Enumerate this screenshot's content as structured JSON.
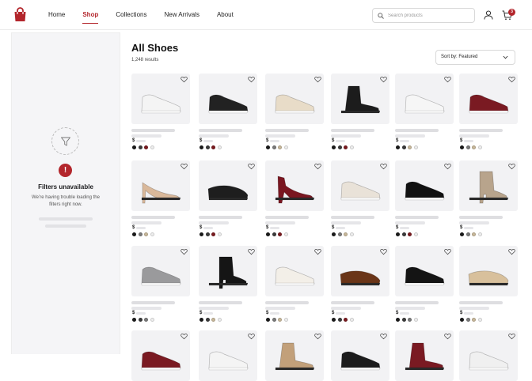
{
  "nav": {
    "items": [
      {
        "label": "Home",
        "active": false
      },
      {
        "label": "Shop",
        "active": true
      },
      {
        "label": "Collections",
        "active": false
      },
      {
        "label": "New Arrivals",
        "active": false
      },
      {
        "label": "About",
        "active": false
      }
    ]
  },
  "search": {
    "placeholder": "Search products",
    "value": ""
  },
  "cart": {
    "count": "3"
  },
  "sidebar": {
    "title": "Filters unavailable",
    "message": "We’re having trouble loading the filters right now.",
    "alert_symbol": "!"
  },
  "main": {
    "title": "All Shoes",
    "result_count": "1,248 results",
    "sort_label": "Sort by: Featured"
  },
  "colors": {
    "accent": "#b3262c"
  },
  "products": [
    {
      "shoe": "white sneaker",
      "color": "#f4f4f4",
      "swatches": [
        "#1a1a1a",
        "#3a3a3a",
        "#7a1a1f",
        "#eeeeee"
      ],
      "price": "$"
    },
    {
      "shoe": "black knit sneaker",
      "color": "#222222",
      "swatches": [
        "#1a1a1a",
        "#3a3a3a",
        "#7a1a1f",
        "#eeeeee"
      ],
      "price": "$"
    },
    {
      "shoe": "beige chunky sneaker",
      "color": "#e8dcc8",
      "swatches": [
        "#1a1a1a",
        "#7a7a7a",
        "#c8b89a",
        "#eeeeee"
      ],
      "price": "$"
    },
    {
      "shoe": "black chelsea boot",
      "color": "#1c1c1c",
      "swatches": [
        "#1a1a1a",
        "#3a3a3a",
        "#7a1a1f",
        "#eeeeee"
      ],
      "price": "$"
    },
    {
      "shoe": "white leather sneaker",
      "color": "#f6f6f6",
      "swatches": [
        "#1a1a1a",
        "#3a3a3a",
        "#c8b89a",
        "#eeeeee"
      ],
      "price": "$"
    },
    {
      "shoe": "burgundy knit sneaker",
      "color": "#7a1a22",
      "swatches": [
        "#1a1a1a",
        "#7a7a7a",
        "#c8b89a",
        "#eeeeee"
      ],
      "price": "$"
    },
    {
      "shoe": "nude pump",
      "color": "#d9b89a",
      "swatches": [
        "#1a1a1a",
        "#7a7a7a",
        "#c8b89a",
        "#eeeeee"
      ],
      "price": "$"
    },
    {
      "shoe": "black loafer",
      "color": "#1e1e1e",
      "swatches": [
        "#1a1a1a",
        "#3a3a3a",
        "#7a1a1f",
        "#eeeeee"
      ],
      "price": "$"
    },
    {
      "shoe": "burgundy strappy heel",
      "color": "#7a1620",
      "swatches": [
        "#1a1a1a",
        "#3a3a3a",
        "#7a1a1f",
        "#eeeeee"
      ],
      "price": "$"
    },
    {
      "shoe": "cream knit sneaker",
      "color": "#e9e2d8",
      "swatches": [
        "#1a1a1a",
        "#7a7a7a",
        "#c8b89a",
        "#eeeeee"
      ],
      "price": "$"
    },
    {
      "shoe": "black skate sneaker",
      "color": "#111111",
      "swatches": [
        "#1a1a1a",
        "#3a3a3a",
        "#7a1a1f",
        "#eeeeee"
      ],
      "price": "$"
    },
    {
      "shoe": "taupe ankle boot",
      "color": "#b8a48c",
      "swatches": [
        "#1a1a1a",
        "#7a7a7a",
        "#c8b89a",
        "#eeeeee"
      ],
      "price": "$"
    },
    {
      "shoe": "grey knit sneaker",
      "color": "#9a9a9c",
      "swatches": [
        "#1a1a1a",
        "#3a3a3a",
        "#7a7a7a",
        "#eeeeee"
      ],
      "price": "$"
    },
    {
      "shoe": "black heeled boot",
      "color": "#151515",
      "swatches": [
        "#1a1a1a",
        "#3a3a3a",
        "#c8b89a",
        "#eeeeee"
      ],
      "price": "$"
    },
    {
      "shoe": "white court sneaker",
      "color": "#f3efe8",
      "swatches": [
        "#1a1a1a",
        "#7a7a7a",
        "#c8b89a",
        "#eeeeee"
      ],
      "price": "$"
    },
    {
      "shoe": "brown derby",
      "color": "#6a3518",
      "swatches": [
        "#1a1a1a",
        "#3a3a3a",
        "#7a1a1f",
        "#eeeeee"
      ],
      "price": "$"
    },
    {
      "shoe": "black white sneaker",
      "color": "#141414",
      "swatches": [
        "#1a1a1a",
        "#3a3a3a",
        "#7a7a7a",
        "#eeeeee"
      ],
      "price": "$"
    },
    {
      "shoe": "gold ballet flat",
      "color": "#d8c09c",
      "swatches": [
        "#1a1a1a",
        "#7a7a7a",
        "#c8b89a",
        "#eeeeee"
      ],
      "price": "$"
    },
    {
      "shoe": "burgundy sneaker",
      "color": "#7a1a22",
      "swatches": [],
      "price": ""
    },
    {
      "shoe": "white sneaker",
      "color": "#f4f4f4",
      "swatches": [],
      "price": ""
    },
    {
      "shoe": "tan boot",
      "color": "#c2a07a",
      "swatches": [],
      "price": ""
    },
    {
      "shoe": "black sneaker",
      "color": "#1c1c1c",
      "swatches": [],
      "price": ""
    },
    {
      "shoe": "burgundy boot",
      "color": "#7a1a22",
      "swatches": [],
      "price": ""
    },
    {
      "shoe": "white sneaker",
      "color": "#f0f0f0",
      "swatches": [],
      "price": ""
    }
  ]
}
